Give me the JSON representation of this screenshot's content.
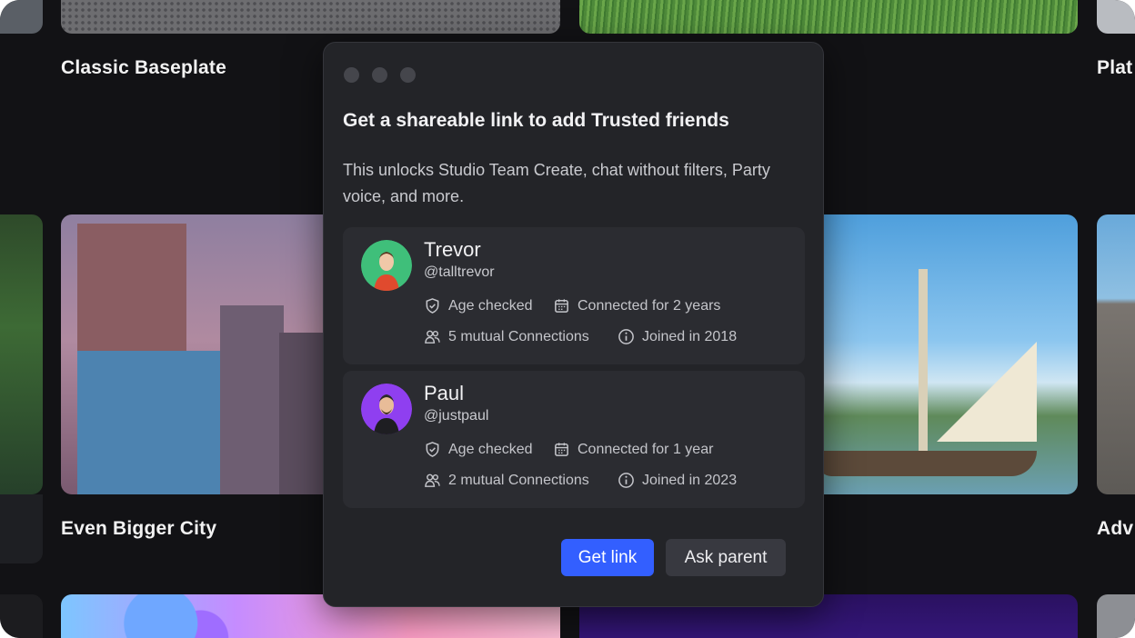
{
  "background": {
    "tiles": [
      {
        "title": "Classic Baseplate"
      },
      {
        "title": "Plat"
      },
      {
        "title": "Even Bigger City"
      },
      {
        "title": "Adv"
      }
    ]
  },
  "modal": {
    "title": "Get a shareable link to add Trusted friends",
    "description": "This unlocks Studio Team Create, chat without filters, Party voice, and more.",
    "friends": [
      {
        "name": "Trevor",
        "handle": "@talltrevor",
        "age_checked": "Age checked",
        "connected": "Connected for 2 years",
        "mutual": "5 mutual Connections",
        "joined": "Joined in 2018",
        "avatar_color": "#3fbf7a",
        "shirt_color": "#e04a2e"
      },
      {
        "name": "Paul",
        "handle": "@justpaul",
        "age_checked": "Age checked",
        "connected": "Connected for 1 year",
        "mutual": "2 mutual Connections",
        "joined": "Joined in 2023",
        "avatar_color": "#8f3ff0",
        "shirt_color": "#1e1e22"
      }
    ],
    "buttons": {
      "primary_label": "Get link",
      "secondary_label": "Ask parent"
    }
  },
  "colors": {
    "accent": "#335fff",
    "modal_bg": "#232428",
    "card_bg": "#2b2c31",
    "page_bg": "#121215"
  }
}
